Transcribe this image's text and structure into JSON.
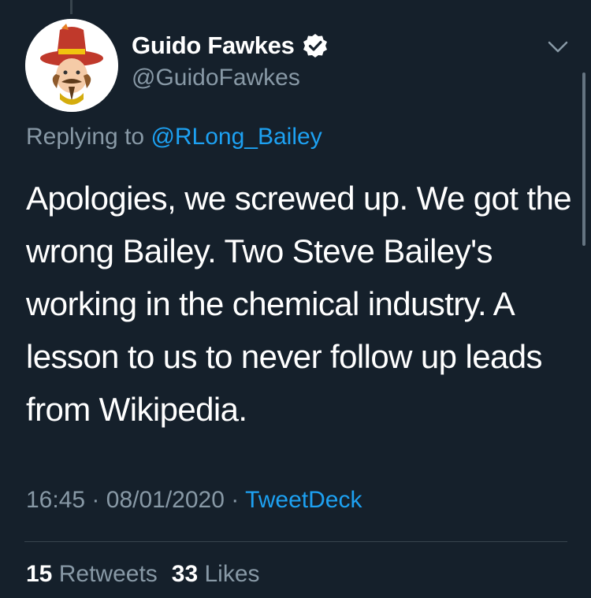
{
  "tweet": {
    "author": {
      "display_name": "Guido Fawkes",
      "handle": "@GuidoFawkes",
      "verified_icon": "verified-badge-icon",
      "avatar_icon": "avatar-guy-fawkes"
    },
    "replying": {
      "prefix": "Replying to",
      "mention": "@RLong_Bailey"
    },
    "text": "Apologies, we screwed up. We got the wrong Bailey. Two Steve Bailey's working in the chemical industry. A lesson to us to never follow up leads from Wikipedia.",
    "time": "16:45",
    "date": "08/01/2020",
    "separator": "·",
    "source": "TweetDeck",
    "stats": {
      "retweets_count": "15",
      "retweets_label": "Retweets",
      "likes_count": "33",
      "likes_label": "Likes"
    }
  },
  "colors": {
    "background": "#15202b",
    "secondary_text": "#8899a6",
    "accent": "#1da1f2"
  }
}
